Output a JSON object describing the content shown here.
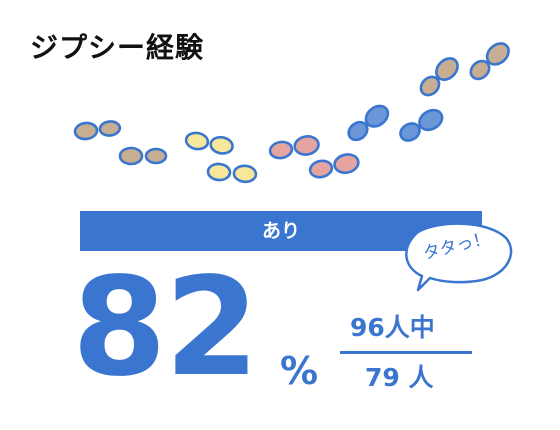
{
  "title": "ジプシー経験",
  "banner_label": "あり",
  "bubble_text": "タタっ！",
  "stat": {
    "percent_value": "82",
    "percent_sign": "%",
    "total_label": "96人中",
    "count_label": "79 人",
    "percent": 82
  },
  "colors": {
    "accent": "#3a76cf",
    "footprint_tan": "#c7ad92",
    "footprint_yellow": "#f7e79a",
    "footprint_pink": "#e6a4a0",
    "footprint_blue": "#6b96d8",
    "outline": "#3a76cf"
  }
}
